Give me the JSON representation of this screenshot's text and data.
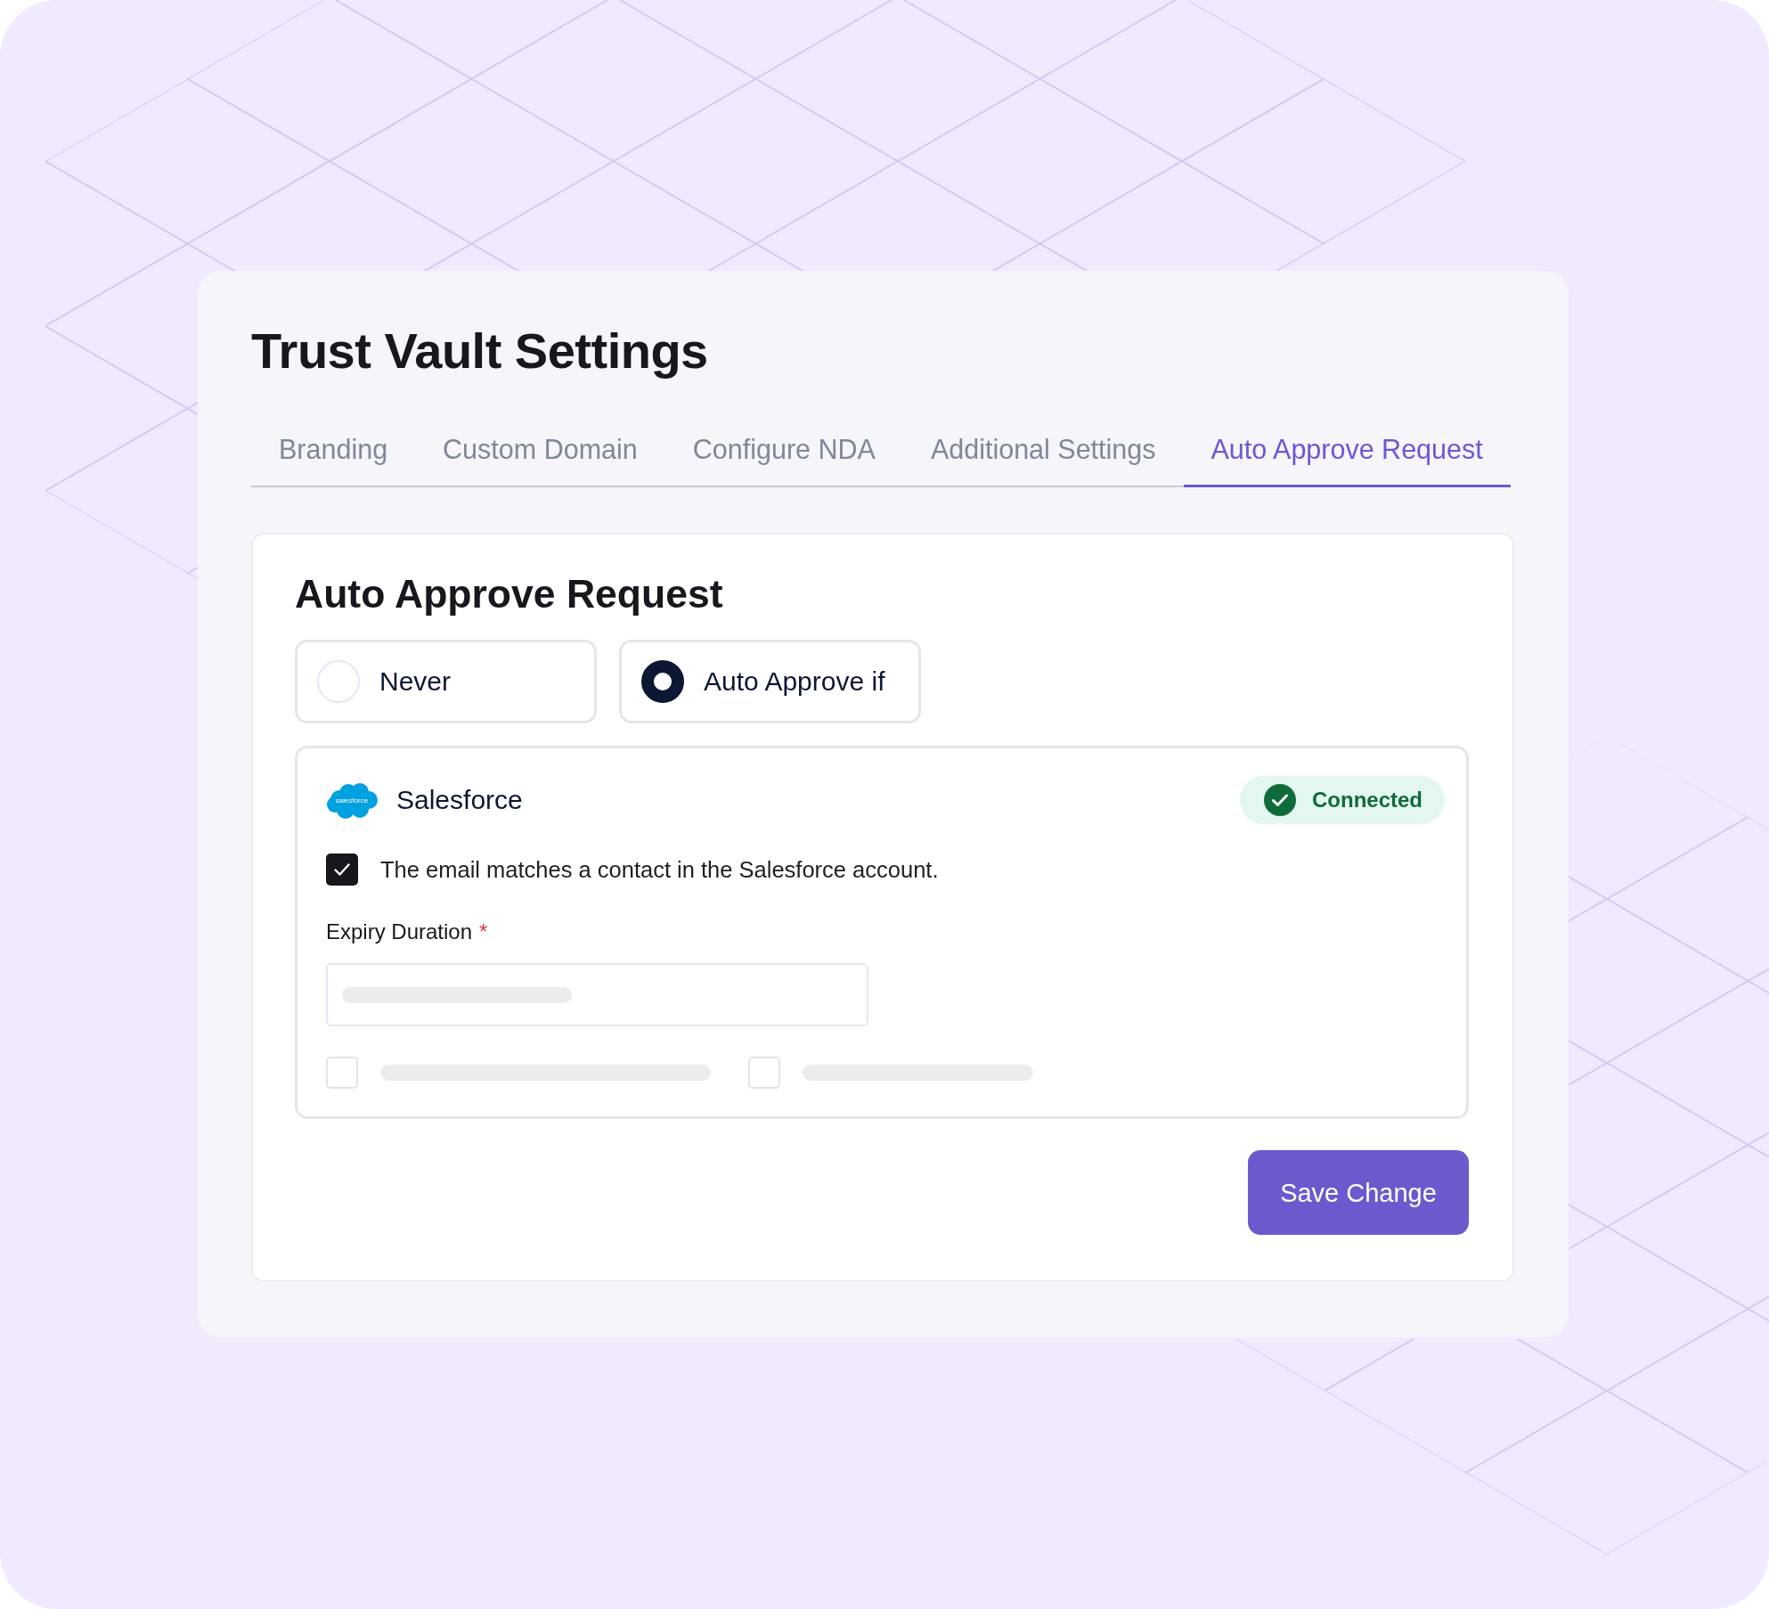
{
  "page": {
    "title": "Trust Vault Settings"
  },
  "tabs": [
    {
      "label": "Branding",
      "selected": false
    },
    {
      "label": "Custom Domain",
      "selected": false
    },
    {
      "label": "Configure NDA",
      "selected": false
    },
    {
      "label": "Additional Settings",
      "selected": false
    },
    {
      "label": "Auto Approve Request",
      "selected": true
    }
  ],
  "section": {
    "heading": "Auto Approve Request",
    "approval_options": [
      {
        "label": "Never",
        "selected": false
      },
      {
        "label": "Auto Approve if",
        "selected": true
      }
    ],
    "integration": {
      "logo_text": "salesforce",
      "name": "Salesforce",
      "status": "Connected",
      "connected": true,
      "conditions": [
        {
          "label": "The email matches a contact in the Salesforce account.",
          "checked": true
        }
      ],
      "expiry": {
        "label": "Expiry Duration",
        "required_mark": "*"
      },
      "loading_options": [
        {
          "checked": false
        },
        {
          "checked": false
        }
      ]
    },
    "save_button": "Save Change"
  }
}
